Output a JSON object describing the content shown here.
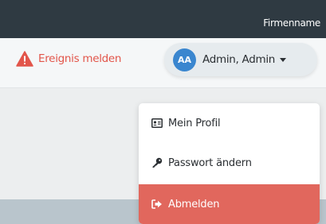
{
  "topbar": {
    "company_name": "Firmenname"
  },
  "header": {
    "report_event_label": "Ereignis melden",
    "report_icon": "warning-triangle-icon",
    "user": {
      "initials": "AA",
      "name": "Admin, Admin",
      "caret_icon": "caret-down-icon"
    }
  },
  "user_menu": {
    "items": [
      {
        "label": "Mein Profil",
        "icon": "id-card-icon"
      },
      {
        "label": "Passwort ändern",
        "icon": "key-icon"
      },
      {
        "label": "Abmelden",
        "icon": "sign-out-icon"
      }
    ]
  },
  "colors": {
    "topbar": "#2f3a42",
    "danger": "#e2554a",
    "avatar": "#3a86cf",
    "logout_bg": "#e1675d"
  }
}
